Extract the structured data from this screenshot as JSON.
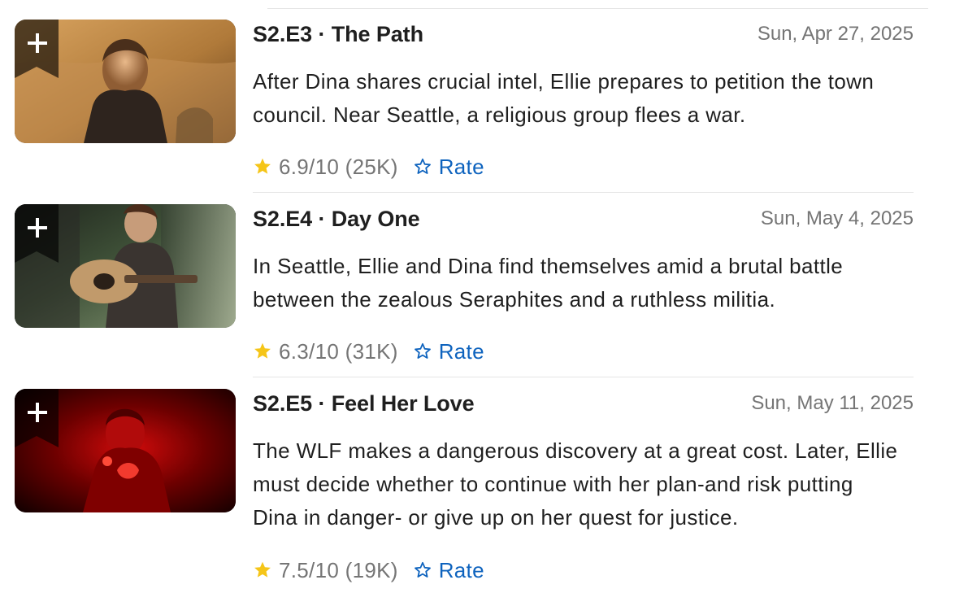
{
  "episodes": [
    {
      "title": "S2.E3 · The Path",
      "air_date": "Sun, Apr 27, 2025",
      "description": "After Dina shares crucial intel, Ellie prepares to petition the town council. Near Seattle, a religious group flees a war.",
      "rating": "6.9/10 (25K)",
      "rate_label": "Rate",
      "thumbnail_colors": {
        "primary": "#b07a3a",
        "secondary": "#d8a35f"
      }
    },
    {
      "title": "S2.E4 · Day One",
      "air_date": "Sun, May 4, 2025",
      "description": "In Seattle, Ellie and Dina find themselves amid a brutal battle between the zealous Seraphites and a ruthless militia.",
      "rating": "6.3/10 (31K)",
      "rate_label": "Rate",
      "thumbnail_colors": {
        "primary": "#3f5138",
        "secondary": "#8a9c78"
      }
    },
    {
      "title": "S2.E5 · Feel Her Love",
      "air_date": "Sun, May 11, 2025",
      "description": "The WLF makes a dangerous discovery at a great cost. Later, Ellie must decide whether to continue with her plan-and risk putting Dina in danger- or give up on her quest for justice.",
      "rating": "7.5/10 (19K)",
      "rate_label": "Rate",
      "thumbnail_colors": {
        "primary": "#4a0000",
        "secondary": "#d10b0b"
      }
    }
  ],
  "colors": {
    "accent_blue": "#0e63be",
    "star_yellow": "#f5c518",
    "muted_text": "#757575",
    "body_text": "#1f1f1f"
  },
  "icons": {
    "watchlist": "plus-icon",
    "rating": "star-filled-icon",
    "rate": "star-outline-icon"
  }
}
